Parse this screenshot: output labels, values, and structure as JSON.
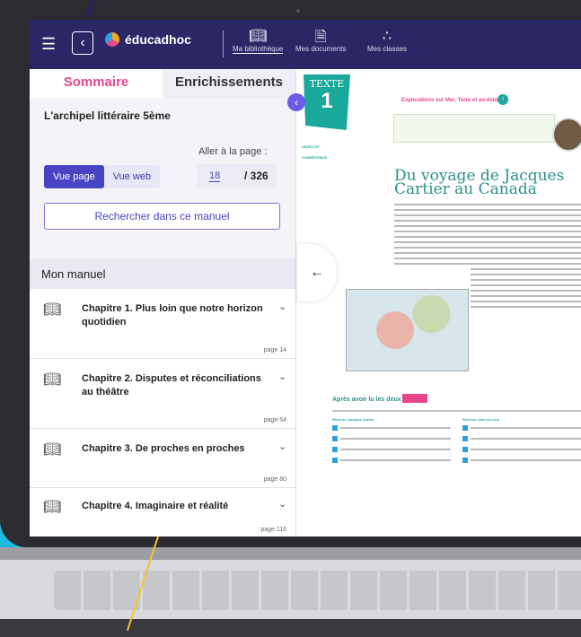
{
  "app": {
    "brand": "éducadhoc",
    "nav": [
      {
        "label": "Ma bibliothèque",
        "icon": "book-open-icon"
      },
      {
        "label": "Mes documents",
        "icon": "document-icon"
      },
      {
        "label": "Mes classes",
        "icon": "users-icon"
      }
    ]
  },
  "sidebar": {
    "tabs": [
      "Sommaire",
      "Enrichissements"
    ],
    "book_title": "L'archipel littéraire 5ème",
    "goto_label": "Aller à la page :",
    "view_page": "Vue page",
    "view_web": "Vue web",
    "current_page": "18",
    "total_pages": "/ 326",
    "search_button": "Rechercher dans ce manuel",
    "section_title": "Mon manuel",
    "chapters": [
      {
        "title": "Chapitre 1. Plus loin que notre horizon quotidien",
        "page": "page 14"
      },
      {
        "title": "Chapitre 2. Disputes et réconciliations au théâtre",
        "page": "page 54"
      },
      {
        "title": "Chapitre 3. De proches en proches",
        "page": "page 80"
      },
      {
        "title": "Chapitre 4. Imaginaire et réalité",
        "page": "page 116"
      }
    ]
  },
  "reader": {
    "badge_word": "TEXTE",
    "badge_number": "1",
    "objectif_label": "OBJECTIF",
    "competence_label": "COMPÉTENCE",
    "theme": "Explorations sur Mer, Terre et au-delà",
    "title": "Du voyage de Jacques Cartier au Canada",
    "after_reading": "Après avoir lu les deux textes",
    "col1_head": "Récit de Jacques Cartier",
    "col2_head": "Récit de Jean de Léry"
  },
  "colors": {
    "appbar": "#2b2767",
    "accent_pink": "#e8468c",
    "accent_purple": "#4745c4",
    "teal": "#1aa89a"
  }
}
